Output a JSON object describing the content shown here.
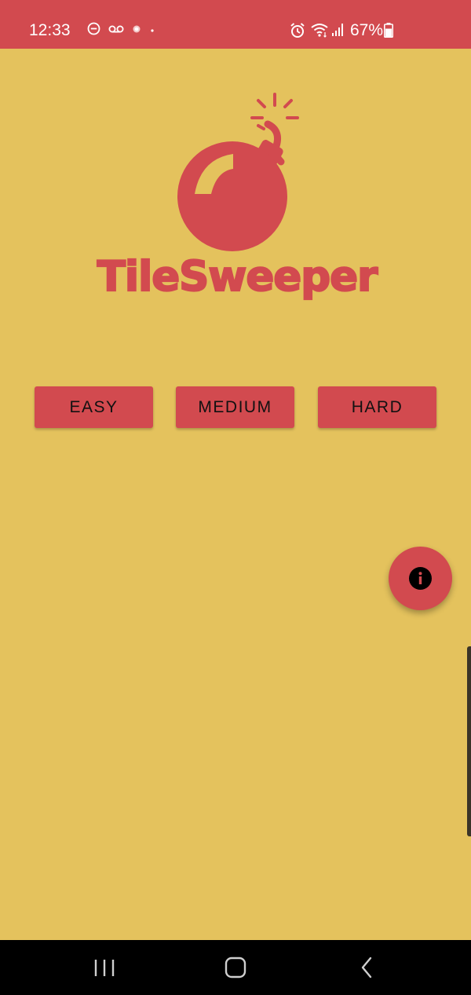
{
  "status_bar": {
    "time": "12:33",
    "battery": "67%",
    "left_icons": [
      "do-not-disturb-icon",
      "voicemail-icon",
      "notification-dot-icon",
      "small-dot-icon"
    ],
    "right_icons": [
      "alarm-icon",
      "wifi-icon",
      "signal-icon",
      "battery-icon"
    ]
  },
  "app": {
    "title": "TileSweeper",
    "colors": {
      "background": "#e4c25d",
      "accent": "#d24a4f",
      "button_text": "#111111"
    }
  },
  "difficulty": {
    "easy": "EASY",
    "medium": "MEDIUM",
    "hard": "HARD"
  },
  "fab": {
    "icon": "info-icon"
  },
  "nav_bar": {
    "icons": [
      "recents-icon",
      "home-icon",
      "back-icon"
    ]
  }
}
